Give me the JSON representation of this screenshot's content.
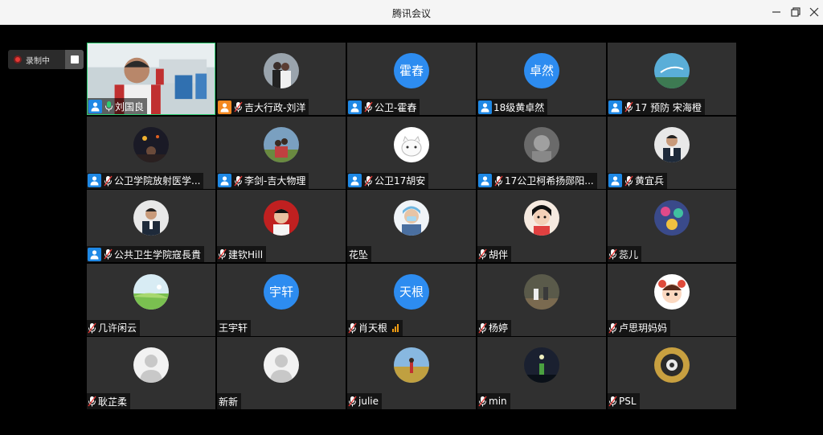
{
  "window": {
    "title": "腾讯会议"
  },
  "recording": {
    "label": "录制中"
  },
  "colors": {
    "accent": "#2d8cf0",
    "host_badge": "#1e88e5",
    "cohost_badge": "#f4881f",
    "recording": "#e53935",
    "active_border": "#2ecc71"
  },
  "participants": [
    {
      "name": "刘国良",
      "role": "host",
      "mic": "speaking",
      "avatar": "video"
    },
    {
      "name": "吉大行政-刘洋",
      "role": "cohost",
      "mic": "muted",
      "avatar": "photo-couple"
    },
    {
      "name": "公卫-霍舂",
      "role": "host",
      "mic": "muted",
      "avatar": "text",
      "avatar_text": "霍舂"
    },
    {
      "name": "18级黄卓然",
      "role": "host",
      "mic": "none",
      "avatar": "text",
      "avatar_text": "卓然"
    },
    {
      "name": "17 预防 宋海橙",
      "role": "host",
      "mic": "muted",
      "avatar": "photo-sky"
    },
    {
      "name": "公卫学院放射医学...",
      "role": "host",
      "mic": "muted",
      "avatar": "photo-night"
    },
    {
      "name": "李剑-吉大物理",
      "role": "host",
      "mic": "muted",
      "avatar": "photo-family"
    },
    {
      "name": "公卫17胡安",
      "role": "host",
      "mic": "muted",
      "avatar": "photo-cat"
    },
    {
      "name": "17公卫柯希扬郧阳...",
      "role": "host",
      "mic": "muted",
      "avatar": "photo-grey"
    },
    {
      "name": "黄宜兵",
      "role": "host",
      "mic": "muted",
      "avatar": "photo-man"
    },
    {
      "name": "公共卫生学院寇長貴",
      "role": "host",
      "mic": "muted",
      "avatar": "photo-man"
    },
    {
      "name": "建钦Hill",
      "role": "none",
      "mic": "muted",
      "avatar": "photo-red"
    },
    {
      "name": "花坠",
      "role": "none",
      "mic": "none",
      "avatar": "photo-mask"
    },
    {
      "name": "胡伴",
      "role": "none",
      "mic": "muted",
      "avatar": "photo-girl"
    },
    {
      "name": "蕊儿",
      "role": "none",
      "mic": "muted",
      "avatar": "photo-colorful"
    },
    {
      "name": "几许闲云",
      "role": "none",
      "mic": "muted",
      "avatar": "photo-meadow"
    },
    {
      "name": "王宇轩",
      "role": "none",
      "mic": "none",
      "avatar": "text",
      "avatar_text": "宇轩"
    },
    {
      "name": "肖天根",
      "role": "none",
      "mic": "muted",
      "avatar": "text",
      "avatar_text": "天根",
      "signal": true
    },
    {
      "name": "杨婷",
      "role": "none",
      "mic": "muted",
      "avatar": "photo-people"
    },
    {
      "name": "卢思玥妈妈",
      "role": "none",
      "mic": "muted",
      "avatar": "photo-cartoon"
    },
    {
      "name": "耿芷柔",
      "role": "none",
      "mic": "muted",
      "avatar": "default"
    },
    {
      "name": "新新",
      "role": "none",
      "mic": "none",
      "avatar": "default"
    },
    {
      "name": "julie",
      "role": "none",
      "mic": "muted",
      "avatar": "photo-field"
    },
    {
      "name": "min",
      "role": "none",
      "mic": "muted",
      "avatar": "photo-dark"
    },
    {
      "name": "PSL",
      "role": "none",
      "mic": "muted",
      "avatar": "photo-ring"
    }
  ]
}
